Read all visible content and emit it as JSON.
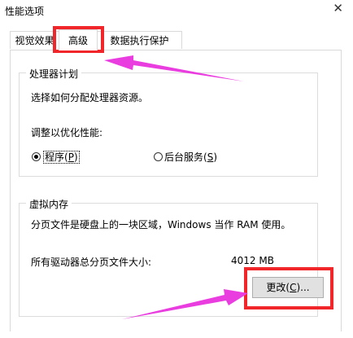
{
  "window": {
    "title": "性能选项",
    "close_glyph": "✕"
  },
  "tabs": {
    "visual": "视觉效果",
    "advanced": "高级",
    "dep": "数据执行保护"
  },
  "processor": {
    "legend": "处理器计划",
    "description": "选择如何分配处理器资源。",
    "adjust_label": "调整以优化性能:",
    "programs_text": "程序(",
    "programs_key": "P",
    "programs_end": ")",
    "programs_checked": true,
    "services_text": "后台服务(",
    "services_key": "S",
    "services_end": ")",
    "services_checked": false
  },
  "virtual_memory": {
    "legend": "虚拟内存",
    "description": "分页文件是硬盘上的一块区域，Windows 当作 RAM 使用。",
    "total_label": "所有驱动器总分页文件大小:",
    "total_value": "4012 MB",
    "change_text": "更改(",
    "change_key": "C",
    "change_end": ")..."
  },
  "annotation_color": "#f0262b",
  "arrow_color": "#ea3de0"
}
